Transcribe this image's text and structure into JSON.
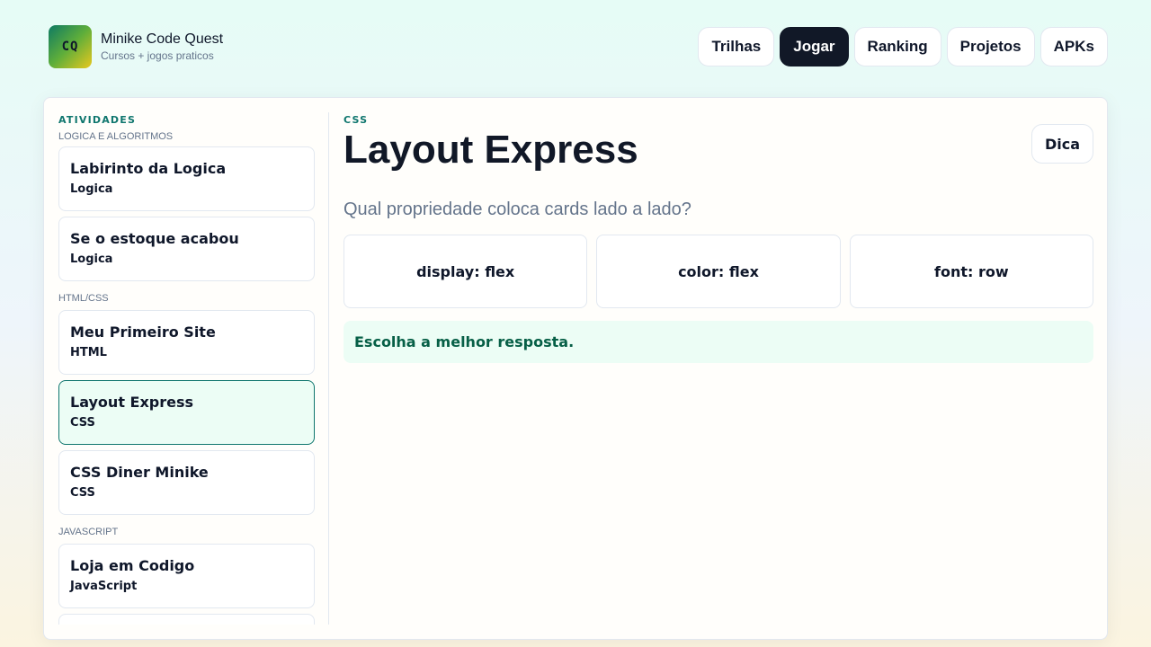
{
  "brand": {
    "logo_text": "CQ",
    "title": "Minike Code Quest",
    "subtitle": "Cursos + jogos praticos"
  },
  "nav": {
    "items": [
      {
        "label": "Trilhas",
        "active": false
      },
      {
        "label": "Jogar",
        "active": true
      },
      {
        "label": "Ranking",
        "active": false
      },
      {
        "label": "Projetos",
        "active": false
      },
      {
        "label": "APKs",
        "active": false
      }
    ]
  },
  "sidebar": {
    "heading": "ATIVIDADES",
    "groups": [
      {
        "label": "LOGICA E ALGORITMOS",
        "items": [
          {
            "title": "Labirinto da Logica",
            "tag": "Logica"
          },
          {
            "title": "Se o estoque acabou",
            "tag": "Logica"
          }
        ]
      },
      {
        "label": "HTML/CSS",
        "items": [
          {
            "title": "Meu Primeiro Site",
            "tag": "HTML"
          },
          {
            "title": "Layout Express",
            "tag": "CSS",
            "selected": true
          },
          {
            "title": "CSS Diner Minike",
            "tag": "CSS"
          }
        ]
      },
      {
        "label": "JAVASCRIPT",
        "items": [
          {
            "title": "Loja em Codigo",
            "tag": "JavaScript"
          }
        ]
      }
    ]
  },
  "main": {
    "eyebrow": "CSS",
    "title": "Layout Express",
    "hint_label": "Dica",
    "question": "Qual propriedade coloca cards lado a lado?",
    "options": [
      "display: flex",
      "color: flex",
      "font: row"
    ],
    "feedback": "Escolha a melhor resposta."
  },
  "colors": {
    "accent": "#0f766e",
    "active_nav": "#111827",
    "selected_bg": "#ecfdf5",
    "feedback_text": "#065f46"
  }
}
